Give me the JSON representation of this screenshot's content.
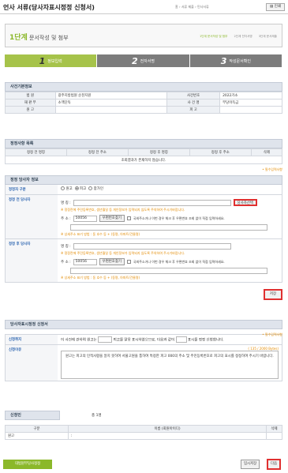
{
  "header": {
    "title": "언사 서류(당사자표시정정 신청서)",
    "breadcrumb": "홈 › 서류 제출 › 민사서류",
    "print_label": "인쇄"
  },
  "step": {
    "num": "1단계",
    "name": "문서작성 및 첨부",
    "sub": [
      "1단계 문서작성 및 첨부",
      "2단계 전자서명",
      "3단계 문서제출"
    ]
  },
  "tabs": [
    {
      "n": "1",
      "label": "정보입력"
    },
    {
      "n": "2",
      "label": "전자서명"
    },
    {
      "n": "3",
      "label": "작성문서확인"
    }
  ],
  "case": {
    "title": "사건기본정보",
    "rows": [
      [
        "법 원",
        "광주지방법원 순천지원",
        "사건번호",
        "2022가소"
      ],
      [
        "재 판 부",
        "소액단독",
        "사 건 명",
        "부당이득금"
      ],
      [
        "원 고",
        "",
        "피 고",
        ""
      ]
    ]
  },
  "corr": {
    "title": "정정사항 목록",
    "headers": [
      "정정 전 명칭",
      "정정 전 주소",
      "정정 후 명칭",
      "정정 후 주소",
      "삭제"
    ],
    "empty": "조회결과가 존재하지 않습니다."
  },
  "party": {
    "title": "정정 당사자 정보",
    "required": "• 필수입력사항",
    "type_label": "정정자 구분",
    "types": [
      "원고",
      "피고",
      "참가인"
    ],
    "before_label": "정정 전 당사자",
    "after_label": "정정 후 당사자",
    "name": "명 칭 :",
    "select_btn": "당사자선택",
    "note1": "※ 정정란에 주민등록번호, 생년월일 등 개인정보가 입력되지 않도록 주의하여 주시기바랍니다.",
    "addr": "주 소 :",
    "zip": "50056",
    "zip_btn": "우편번호찾기",
    "foreign": "국외주소거나 이번 경우 체크 후 우편번호 조회 없이 직접 입력하세요.",
    "note2": "※ 상세주소 표기 방법 : 동 호수 등 + (동명, 아파트/건물명)",
    "note3": "※ 정정란에 주민등록번호, 생년월일 등 개인정보가 입력되지 않도록 주의하여 주시기바랍니다.",
    "save": "저장"
  },
  "apply": {
    "title": "당사자표시정정 신청서",
    "required": "• 필수입력사항",
    "purpose_label": "신청취지",
    "purpose": "이 사건에 관하여 원고는",
    "purpose_mid": "피고를 말못 표시하였으므로, 다음과 같이",
    "purpose_end": "표시를 정정 신청합니다.",
    "reason_label": "신청이유",
    "count": "( 135 / 2000 Bytes)",
    "reason": "원고는 피고의 인적사항을 알지 못하여 서울고원을 통하여 특정한 피고 000의 주소 및 주민등록번호로 피고의 표시를 정정하여 주시기 바랍니다."
  },
  "applicant": {
    "title": "신청인",
    "total": "총 1명",
    "headers": [
      "구분",
      "이름 (회원아이디)",
      "삭제"
    ],
    "rows": [
      [
        "원고",
        ":",
        ""
      ]
    ]
  },
  "footer": {
    "left": "대법원부당사정정",
    "temp": "임시저장",
    "next": "다음"
  }
}
